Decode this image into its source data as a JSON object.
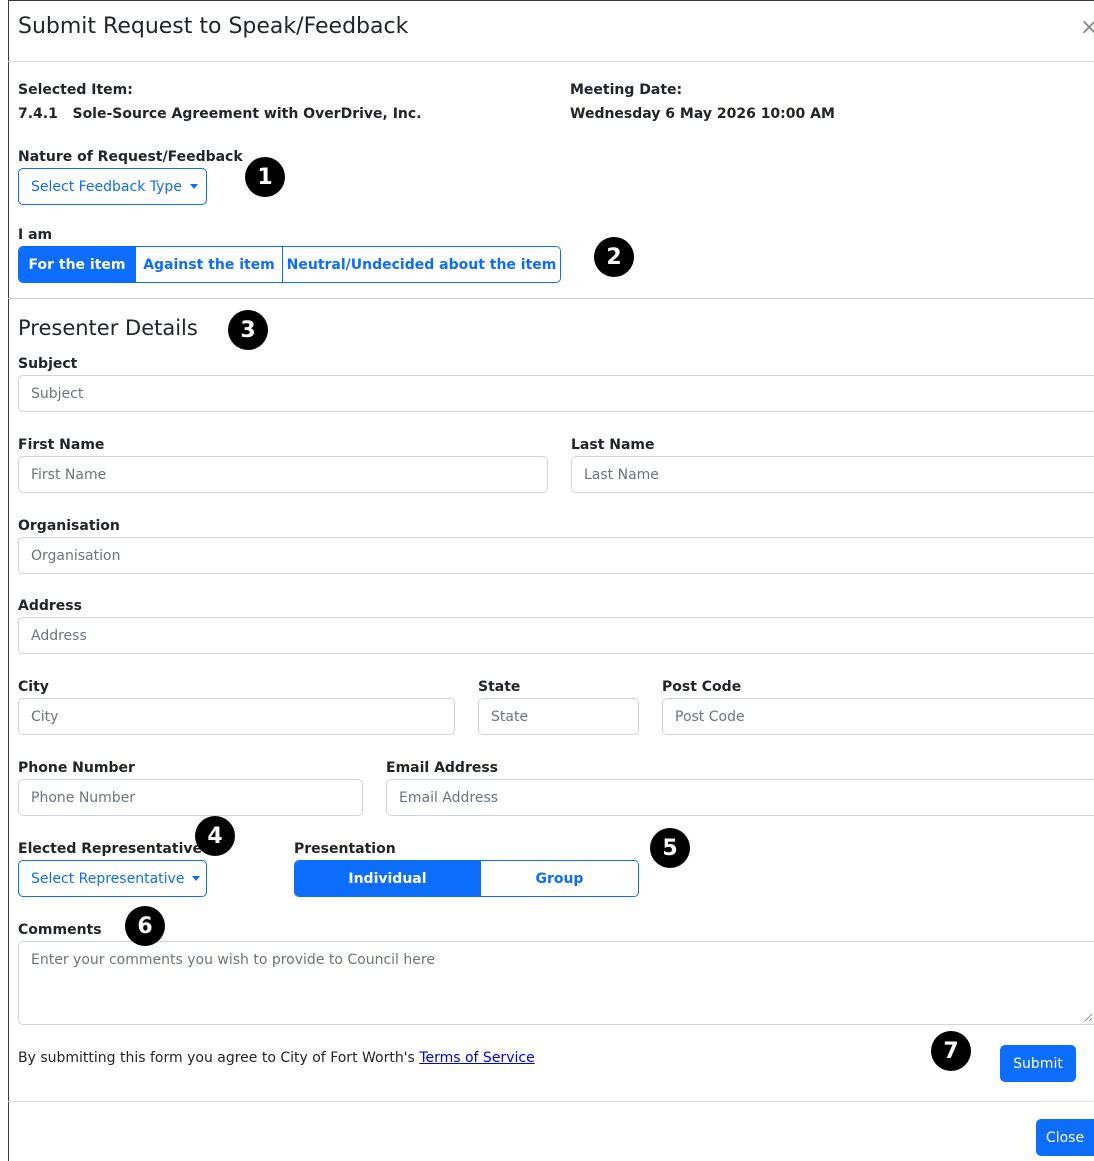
{
  "modal": {
    "title": "Submit Request to Speak/Feedback",
    "close_icon": "×"
  },
  "selected_item": {
    "label": "Selected Item:",
    "value": "7.4.1   Sole-Source Agreement with OverDrive, Inc."
  },
  "meeting_date": {
    "label": "Meeting Date:",
    "value": "Wednesday 6 May 2026 10:00 AM"
  },
  "nature": {
    "label": "Nature of Request/Feedback",
    "dropdown": "Select Feedback Type"
  },
  "stance": {
    "label": "I am",
    "options": [
      "For the item",
      "Against the item",
      "Neutral/Undecided about the item"
    ],
    "selected": "For the item"
  },
  "presenter": {
    "heading": "Presenter Details",
    "subject": {
      "label": "Subject",
      "placeholder": "Subject"
    },
    "first_name": {
      "label": "First Name",
      "placeholder": "First Name"
    },
    "last_name": {
      "label": "Last Name",
      "placeholder": "Last Name"
    },
    "organisation": {
      "label": "Organisation",
      "placeholder": "Organisation"
    },
    "address": {
      "label": "Address",
      "placeholder": "Address"
    },
    "city": {
      "label": "City",
      "placeholder": "City"
    },
    "state": {
      "label": "State",
      "placeholder": "State"
    },
    "post_code": {
      "label": "Post Code",
      "placeholder": "Post Code"
    },
    "phone": {
      "label": "Phone Number",
      "placeholder": "Phone Number"
    },
    "email": {
      "label": "Email Address",
      "placeholder": "Email Address"
    },
    "representative": {
      "label": "Elected Representative",
      "dropdown": "Select Representative"
    },
    "presentation": {
      "label": "Presentation",
      "options": [
        "Individual",
        "Group"
      ],
      "selected": "Individual"
    },
    "comments": {
      "label": "Comments",
      "placeholder": "Enter your comments you wish to provide to Council here"
    }
  },
  "footer": {
    "terms_text": "By submitting this form you agree to City of Fort Worth's ",
    "terms_link": "Terms of Service",
    "submit": "Submit",
    "close": "Close"
  },
  "callouts": [
    "1",
    "2",
    "3",
    "4",
    "5",
    "6",
    "7"
  ],
  "colors": {
    "primary": "#0d6efd",
    "callout": "#000000"
  }
}
